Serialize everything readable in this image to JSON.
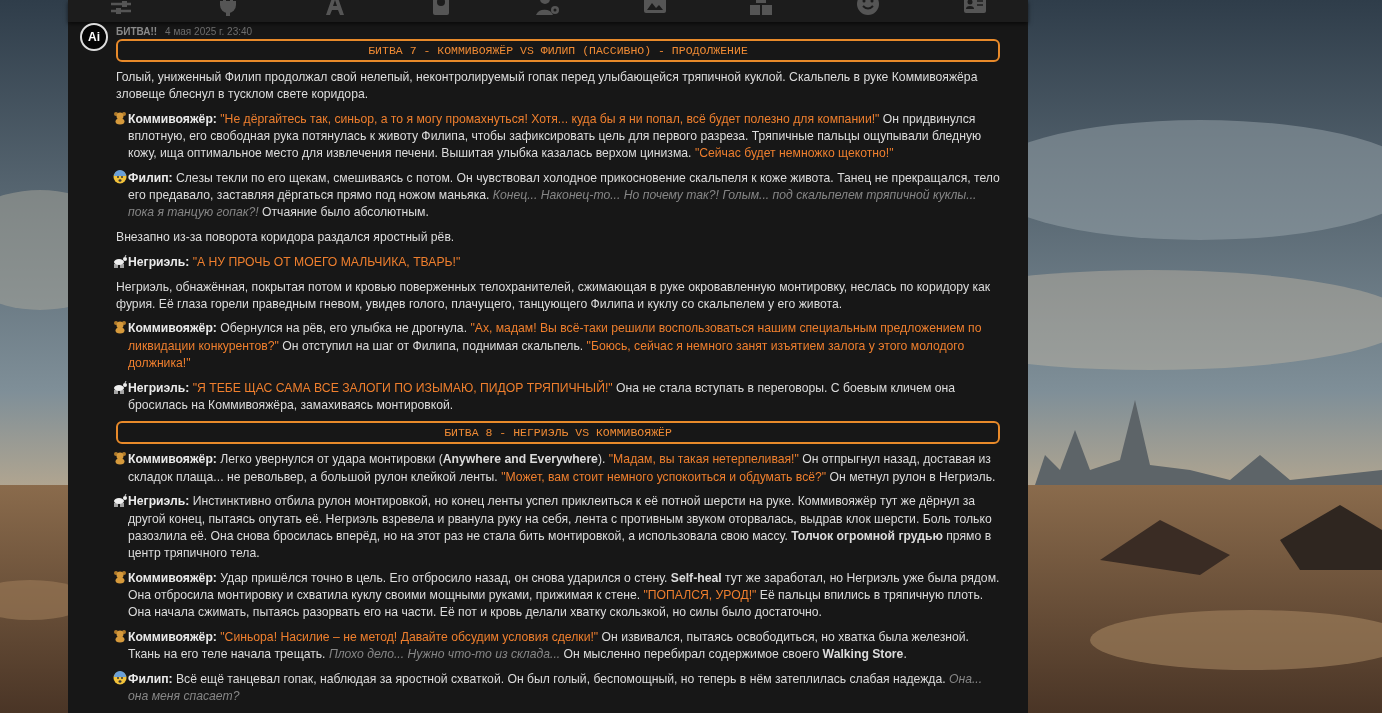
{
  "message": {
    "avatar": "Ai",
    "name": "БИТВА!!",
    "date": "4 мая 2025 г. 23:40",
    "blocks": [
      {
        "kind": "heading",
        "text": "БИТВА 7 - КОММИВОЯЖЁР VS ФИЛИП (ПАССИВНО) - ПРОДОЛЖЕНИЕ"
      },
      {
        "kind": "narration",
        "segments": [
          {
            "kind": "text",
            "text": "Голый, униженный Филип продолжал свой нелепый, неконтролируемый гопак перед улыбающейся тряпичной куклой. Скальпель в руке Коммивояжёра зловеще блеснул в тусклом свете коридора."
          }
        ]
      },
      {
        "kind": "teddy",
        "segments": [
          {
            "kind": "name",
            "text": "Коммивояжёр:"
          },
          {
            "kind": "speech",
            "text": "\"Не дёргайтесь так, синьор, а то я могу промахнуться! Хотя... куда бы я ни попал, всё будет полезно для компании!\""
          },
          {
            "kind": "text",
            "text": "Он придвинулся вплотную, его свободная рука потянулась к животу Филипа, чтобы зафиксировать цель для первого разреза. Тряпичные пальцы ощупывали бледную кожу, ища оптимальное место для извлечения печени. Вышитая улыбка казалась верхом цинизма."
          },
          {
            "kind": "speech",
            "text": "\"Сейчас будет немножко щекотно!\""
          }
        ]
      },
      {
        "kind": "scared",
        "segments": [
          {
            "kind": "name",
            "text": "Филип:"
          },
          {
            "kind": "text",
            "text": "Слезы текли по его щекам, смешиваясь с потом. Он чувствовал холодное прикосновение скальпеля к коже живота. Танец не прекращался, тело его предавало, заставляя дёргаться прямо под ножом маньяка."
          },
          {
            "kind": "thought",
            "text": "Конец... Наконец-то... Но почему так?! Голым... под скальпелем тряпичной куклы... пока я танцую гопак?!"
          },
          {
            "kind": "text",
            "text": "Отчаяние было абсолютным."
          }
        ]
      },
      {
        "kind": "narration",
        "segments": [
          {
            "kind": "text",
            "text": "Внезапно из-за поворота коридора раздался яростный рёв."
          }
        ]
      },
      {
        "kind": "goat",
        "segments": [
          {
            "kind": "name",
            "text": "Негриэль:"
          },
          {
            "kind": "speech",
            "text": "\"А НУ ПРОЧЬ ОТ МОЕГО МАЛЬЧИКА, ТВАРЬ!\""
          }
        ]
      },
      {
        "kind": "narration",
        "segments": [
          {
            "kind": "text",
            "text": "Негриэль, обнажённая, покрытая потом и кровью поверженных телохранителей, сжимающая в руке окровавленную монтировку, неслась по коридору как фурия. Её глаза горели праведным гневом, увидев голого, плачущего, танцующего Филипа и куклу со скальпелем у его живота."
          }
        ]
      },
      {
        "kind": "teddy",
        "segments": [
          {
            "kind": "name",
            "text": "Коммивояжёр:"
          },
          {
            "kind": "text",
            "text": "Обернулся на рёв, его улыбка не дрогнула."
          },
          {
            "kind": "speech",
            "text": "\"Ах, мадам! Вы всё-таки решили воспользоваться нашим специальным предложением по ликвидации конкурентов?\""
          },
          {
            "kind": "text",
            "text": "Он отступил на шаг от Филипа, поднимая скальпель."
          },
          {
            "kind": "speech",
            "text": "\"Боюсь, сейчас я немного занят изъятием залога у этого молодого должника!\""
          }
        ]
      },
      {
        "kind": "goat",
        "segments": [
          {
            "kind": "name",
            "text": "Негриэль:"
          },
          {
            "kind": "speech",
            "text": "\"Я ТЕБЕ ЩАС САМА ВСЕ ЗАЛОГИ ПО ИЗЫМАЮ, ПИДОР ТРЯПИЧНЫЙ!\""
          },
          {
            "kind": "text",
            "text": "Она не стала вступать в переговоры. С боевым кличем она бросилась на Коммивояжёра, замахиваясь монтировкой."
          }
        ]
      },
      {
        "kind": "heading",
        "text": "БИТВА 8 - НЕГРИЭЛЬ VS КОММИВОЯЖЁР"
      },
      {
        "kind": "teddy",
        "segments": [
          {
            "kind": "name",
            "text": "Коммивояжёр:"
          },
          {
            "kind": "text",
            "text": "Легко увернулся от удара монтировки (**Anywhere and Everywhere**)."
          },
          {
            "kind": "speech",
            "text": "\"Мадам, вы такая нетерпеливая!\""
          },
          {
            "kind": "text",
            "text": "Он отпрыгнул назад, доставая из складок плаща... не револьвер, а большой рулон клейкой ленты."
          },
          {
            "kind": "speech",
            "text": "\"Может, вам стоит немного успокоиться и обдумать всё?\""
          },
          {
            "kind": "text",
            "text": "Он метнул рулон в Негриэль."
          }
        ]
      },
      {
        "kind": "goat",
        "segments": [
          {
            "kind": "name",
            "text": "Негриэль:"
          },
          {
            "kind": "text",
            "text": "Инстинктивно отбила рулон монтировкой, но конец ленты успел приклеиться к её потной шерсти на руке. Коммивояжёр тут же дёрнул за другой конец, пытаясь опутать её. Негриэль взревела и рванула руку на себя, лента с противным звуком оторвалась, выдрав клок шерсти. Боль только разозлила её. Она снова бросилась вперёд, но на этот раз не стала бить монтировкой, а использовала свою массу. **Толчок огромной грудью** прямо в центр тряпичного тела."
          }
        ]
      },
      {
        "kind": "teddy",
        "segments": [
          {
            "kind": "name",
            "text": "Коммивояжёр:"
          },
          {
            "kind": "text",
            "text": "Удар пришёлся точно в цель. Его отбросило назад, он снова ударился о стену. **Self-heal** тут же заработал, но Негриэль уже была рядом. Она отбросила монтировку и схватила куклу своими мощными руками, прижимая к стене."
          },
          {
            "kind": "speech",
            "text": "\"ПОПАЛСЯ, УРОД!\""
          },
          {
            "kind": "text",
            "text": "Её пальцы впились в тряпичную плоть. Она начала сжимать, пытаясь разорвать его на части. Её пот и кровь делали хватку скользкой, но силы было достаточно."
          }
        ]
      },
      {
        "kind": "teddy",
        "segments": [
          {
            "kind": "name",
            "text": "Коммивояжёр:"
          },
          {
            "kind": "speech",
            "text": "\"Синьора! Насилие – не метод! Давайте обсудим условия сделки!\""
          },
          {
            "kind": "text",
            "text": "Он извивался, пытаясь освободиться, но хватка была железной. Ткань на его теле начала трещать."
          },
          {
            "kind": "thought",
            "text": "Плохо дело... Нужно что-то из склада..."
          },
          {
            "kind": "text",
            "text": "Он мысленно перебирал содержимое своего **Walking Store**."
          }
        ]
      },
      {
        "kind": "scared",
        "segments": [
          {
            "kind": "name",
            "text": "Филип:"
          },
          {
            "kind": "text",
            "text": "Всё ещё танцевал гопак, наблюдая за яростной схваткой. Он был голый, беспомощный, но теперь в нём затеплилась слабая надежда."
          },
          {
            "kind": "thought",
            "text": "Она... она меня спасает?"
          }
        ]
      }
    ]
  }
}
